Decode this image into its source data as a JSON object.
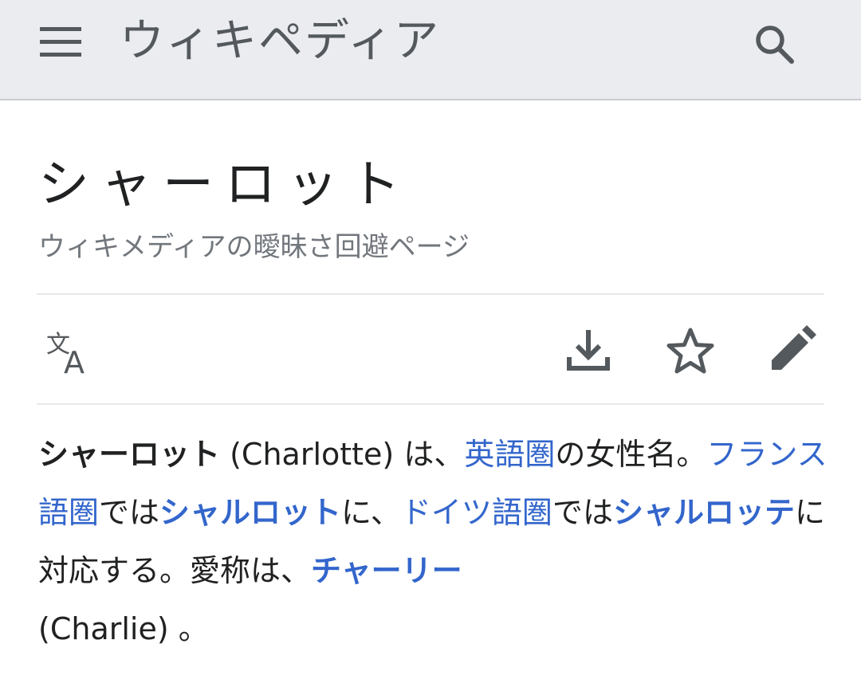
{
  "header": {
    "logo_text": "ウィキペディア",
    "menu_icon": "menu-icon",
    "search_icon": "search-icon"
  },
  "page": {
    "title": "シャーロット",
    "subtitle": "ウィキメディアの曖昧さ回避ページ"
  },
  "actions": {
    "language_icon": "translate-icon",
    "download_icon": "download-icon",
    "star_icon": "star-icon",
    "edit_icon": "edit-pencil-icon"
  },
  "content": {
    "term": "シャーロット",
    "t1": " (Charlotte) は、",
    "link_english": "英語圏",
    "t2": "の女性名。",
    "link_french": "フランス語圏",
    "t3": "では",
    "link_charlotte": "シャルロット",
    "t4": "に、",
    "link_german": "ドイツ語圏",
    "t5": "では",
    "link_scharlotte": "シャルロッテ",
    "t6": "に対応する。愛称は、",
    "link_charlie": "チャーリー",
    "t7": " (Charlie) 。"
  },
  "colors": {
    "header_bg": "#eaecf0",
    "link": "#3366cc",
    "text": "#202122",
    "muted": "#72777d",
    "icon": "#54595d"
  }
}
